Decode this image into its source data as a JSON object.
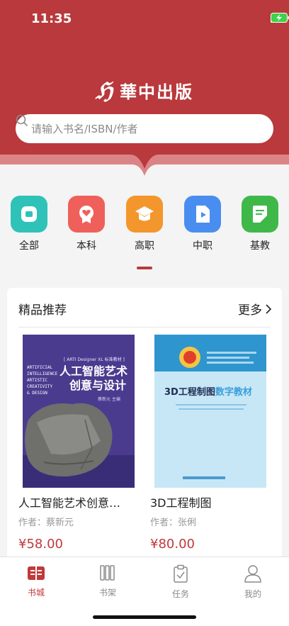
{
  "status_bar": {
    "time": "11:35"
  },
  "brand": {
    "mark": "ℌ",
    "name": "華中出版"
  },
  "search": {
    "placeholder": "请输入书名/ISBN/作者"
  },
  "categories": [
    {
      "label": "全部",
      "icon": "chat-bubble-icon",
      "color": "#2fc2b8"
    },
    {
      "label": "本科",
      "icon": "badge-heart-icon",
      "color": "#f0605a"
    },
    {
      "label": "高职",
      "icon": "graduation-cap-icon",
      "color": "#f3962c"
    },
    {
      "label": "中职",
      "icon": "video-file-icon",
      "color": "#4a8df0"
    },
    {
      "label": "基教",
      "icon": "document-icon",
      "color": "#3fb84a"
    }
  ],
  "recommend": {
    "title": "精品推荐",
    "more": "更多",
    "books": [
      {
        "title": "人工智能艺术创意…",
        "author": "作者：蔡新元",
        "price": "¥58.00",
        "cover": {
          "series": "[ ARTI Designer XL 标准教材 ]",
          "en_lines": [
            "ARTIFICIAL",
            "INTELLIGENCE",
            "ARTISTIC",
            "CREATIVITY",
            "& DESIGN"
          ],
          "title_line1": "人工智能艺术",
          "title_line2": "创意与设计",
          "editor": "蔡新元  主编"
        }
      },
      {
        "title": "3D工程制图",
        "author": "作者：张俐",
        "price": "¥80.00",
        "cover": {
          "title_main": "3D工程制图",
          "title_accent": "数字教材"
        }
      }
    ]
  },
  "tabbar": [
    {
      "label": "书城",
      "icon": "book-shop-icon",
      "active": true
    },
    {
      "label": "书架",
      "icon": "bookshelf-icon",
      "active": false
    },
    {
      "label": "任务",
      "icon": "clipboard-check-icon",
      "active": false
    },
    {
      "label": "我的",
      "icon": "person-icon",
      "active": false
    }
  ],
  "colors": {
    "brand_red": "#b83a3c",
    "price_red": "#c0393b"
  }
}
